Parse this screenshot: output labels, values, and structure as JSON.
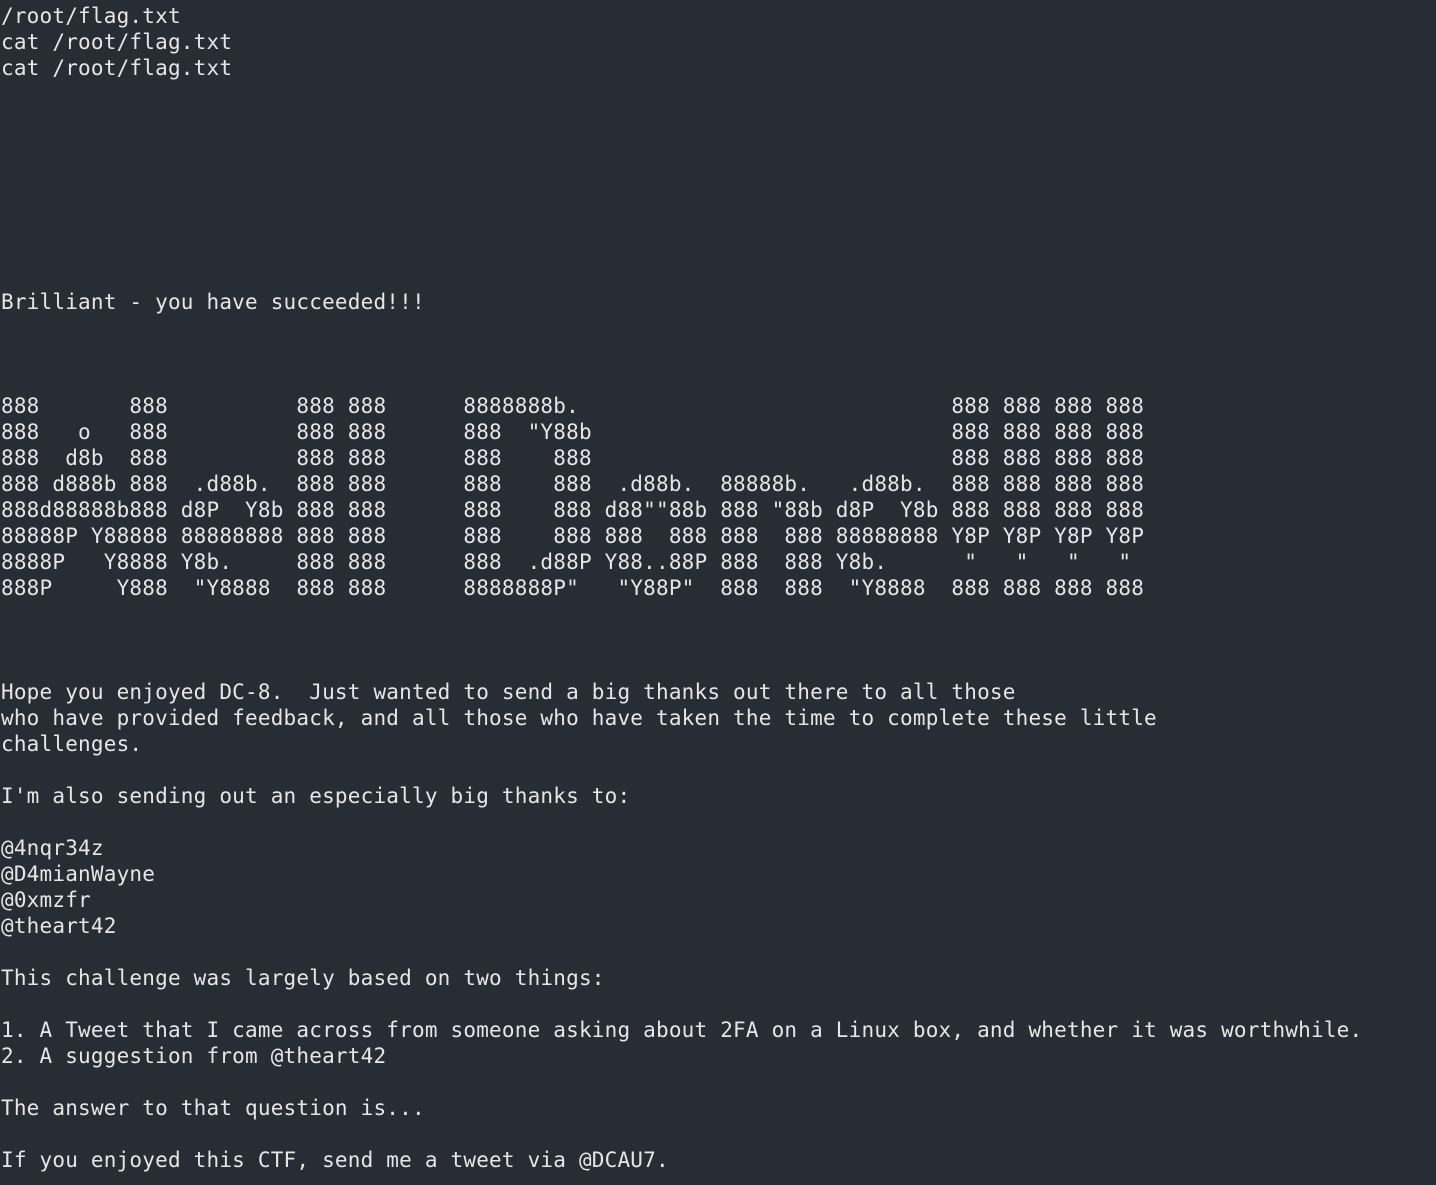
{
  "terminal": {
    "background_color": "#282c34",
    "text_color": "#e6e6e6",
    "lines": [
      "",
      "/root/flag.txt",
      "cat /root/flag.txt",
      "cat /root/flag.txt",
      "",
      "",
      "",
      "",
      "",
      "",
      "",
      "",
      "Brilliant - you have succeeded!!!",
      "",
      "",
      "",
      "888       888          888 888      8888888b.                             888 888 888 888",
      "888   o   888          888 888      888  \"Y88b                            888 888 888 888",
      "888  d8b  888          888 888      888    888                            888 888 888 888",
      "888 d888b 888  .d88b.  888 888      888    888  .d88b.  88888b.   .d88b.  888 888 888 888",
      "888d88888b888 d8P  Y8b 888 888      888    888 d88\"\"88b 888 \"88b d8P  Y8b 888 888 888 888",
      "88888P Y88888 88888888 888 888      888    888 888  888 888  888 88888888 Y8P Y8P Y8P Y8P",
      "8888P   Y8888 Y8b.     888 888      888  .d88P Y88..88P 888  888 Y8b.      \"   \"   \"   \"",
      "888P     Y888  \"Y8888  888 888      8888888P\"   \"Y88P\"  888  888  \"Y8888  888 888 888 888",
      "",
      "",
      "",
      "Hope you enjoyed DC-8.  Just wanted to send a big thanks out there to all those",
      "who have provided feedback, and all those who have taken the time to complete these little",
      "challenges.",
      "",
      "I'm also sending out an especially big thanks to:",
      "",
      "@4nqr34z",
      "@D4mianWayne",
      "@0xmzfr",
      "@theart42",
      "",
      "This challenge was largely based on two things:",
      "",
      "1. A Tweet that I came across from someone asking about 2FA on a Linux box, and whether it was worthwhile.",
      "2. A suggestion from @theart42",
      "",
      "The answer to that question is...",
      "",
      "If you enjoyed this CTF, send me a tweet via @DCAU7."
    ]
  }
}
